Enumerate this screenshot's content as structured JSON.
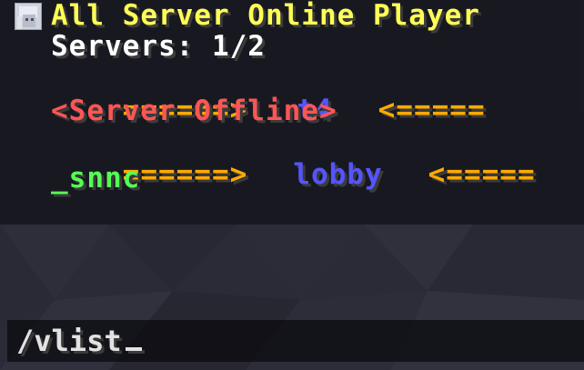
{
  "chat": {
    "title": "All Server Online Player",
    "servers_summary": "Servers: 1/2",
    "lines": [
      {
        "left": "======>",
        "name": "t4",
        "right": "<====="
      },
      {
        "status": "<Server Offline>"
      },
      {
        "left": "======>",
        "name": "lobby",
        "right": "<====="
      },
      {
        "player": "_snnc"
      }
    ]
  },
  "command_input": {
    "value": "/vlist"
  },
  "colors": {
    "title": "#ffff55",
    "text_white": "#ffffff",
    "arrow_gold": "#ffaa00",
    "server_name_blue": "#5555ff",
    "offline_red": "#ff5555",
    "player_green": "#55ff55",
    "background": "#23242e"
  },
  "icons": {
    "avatar": "player-head-icon"
  }
}
